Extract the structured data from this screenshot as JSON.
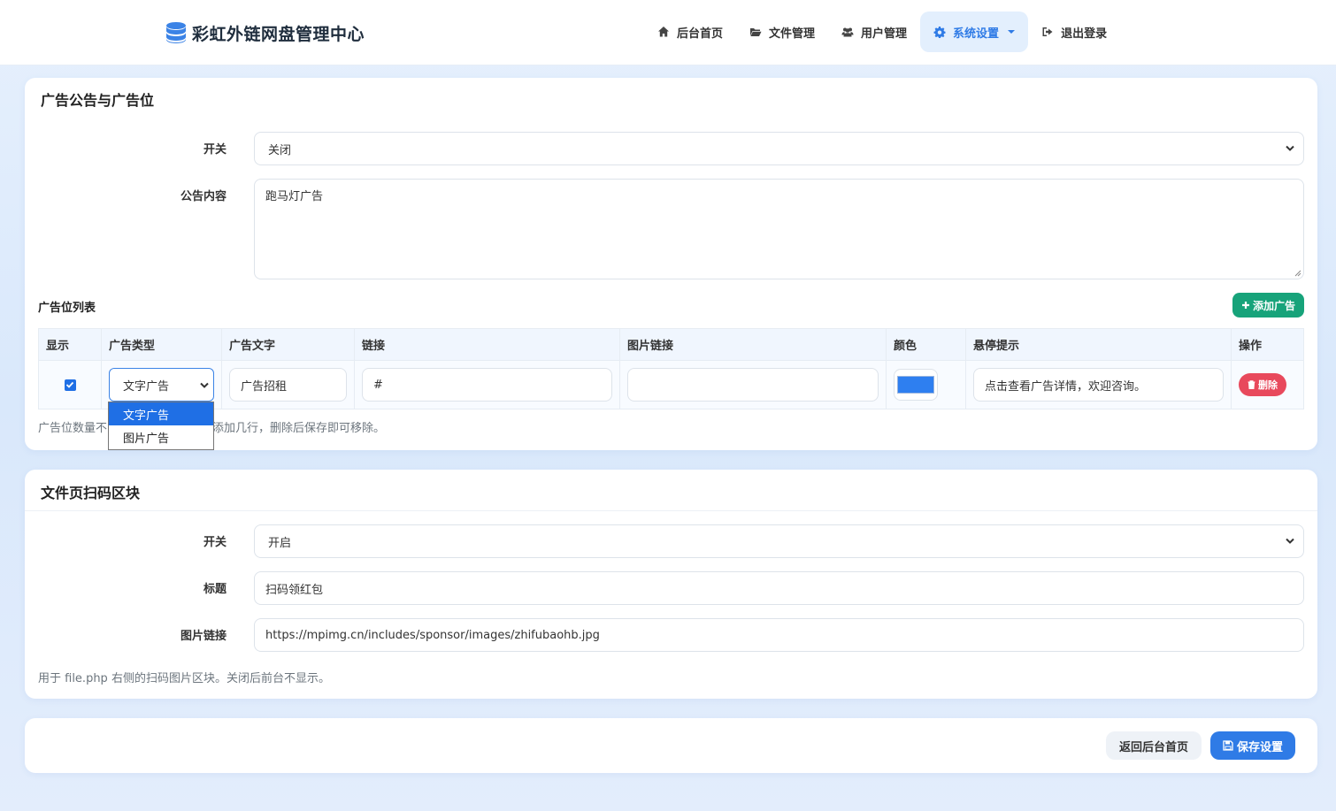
{
  "brand": {
    "title": "彩虹外链网盘管理中心",
    "icon": "database-icon"
  },
  "nav": {
    "items": [
      {
        "label": "后台首页",
        "icon": "home-icon"
      },
      {
        "label": "文件管理",
        "icon": "folder-icon"
      },
      {
        "label": "用户管理",
        "icon": "users-icon"
      },
      {
        "label": "系统设置",
        "icon": "gear-icon",
        "active": true
      },
      {
        "label": "退出登录",
        "icon": "sign-out-icon"
      }
    ]
  },
  "ad_panel": {
    "title": "广告公告与广告位",
    "switch_label": "开关",
    "switch_value": "关闭",
    "notice_label": "公告内容",
    "notice_value": "跑马灯广告",
    "list_title": "广告位列表",
    "add_button": "添加广告",
    "columns": [
      "显示",
      "广告类型",
      "广告文字",
      "链接",
      "图片链接",
      "颜色",
      "悬停提示",
      "操作"
    ],
    "row": {
      "show": true,
      "type": "文字广告",
      "text": "广告招租",
      "link": "#",
      "image": "",
      "color": "#2e7ff0",
      "tooltip": "点击查看广告详情，欢迎咨询。",
      "delete_label": "删除"
    },
    "type_options": [
      "文字广告",
      "图片广告"
    ],
    "help_prefix": "广告位数量不",
    "help_suffix": "添加几行，删除后保存即可移除。"
  },
  "qr_panel": {
    "title": "文件页扫码区块",
    "switch_label": "开关",
    "switch_value": "开启",
    "title_label": "标题",
    "title_value": "扫码领红包",
    "image_label": "图片链接",
    "image_value": "https://mpimg.cn/includes/sponsor/images/zhifubaohb.jpg",
    "help": "用于 file.php 右侧的扫码图片区块。关闭后前台不显示。"
  },
  "actions": {
    "back_label": "返回后台首页",
    "save_label": "保存设置"
  }
}
